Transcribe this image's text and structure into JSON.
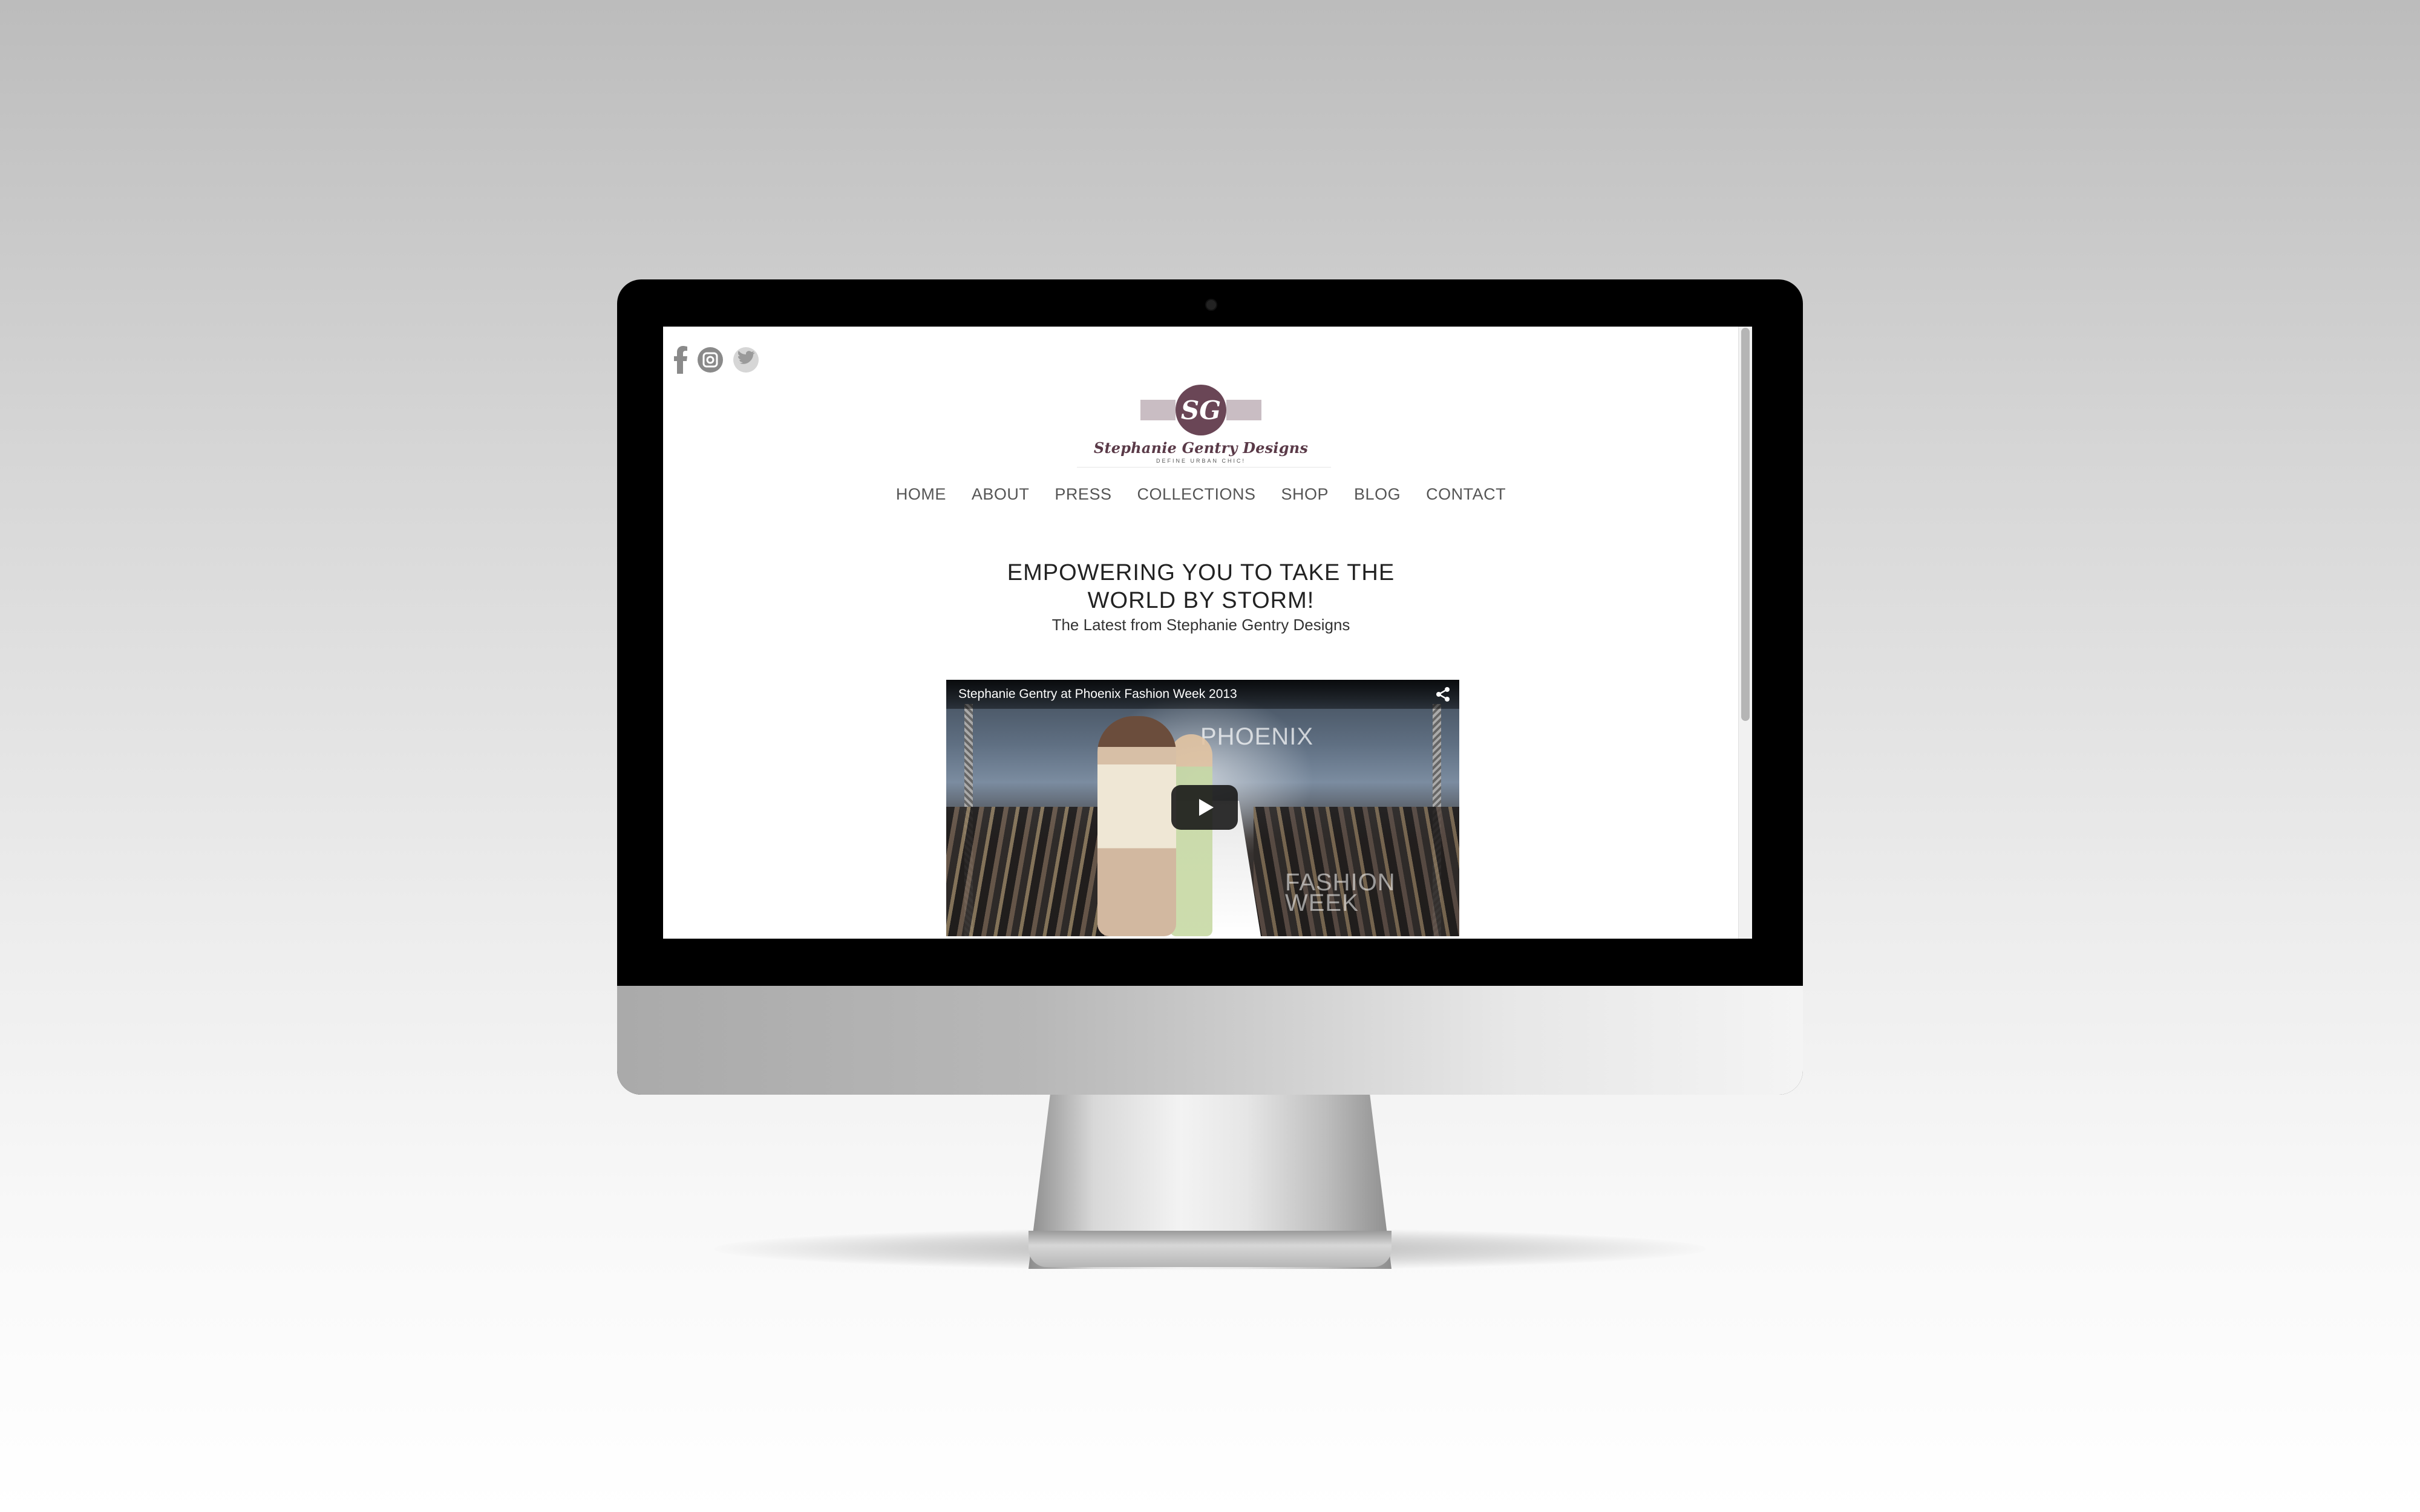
{
  "social": {
    "icons": [
      "facebook-icon",
      "instagram-icon",
      "twitter-icon"
    ]
  },
  "logo": {
    "monogram": "SG",
    "name": "Stephanie Gentry Designs",
    "tagline": "DEFINE URBAN CHIC!"
  },
  "nav": {
    "items": [
      "HOME",
      "ABOUT",
      "PRESS",
      "COLLECTIONS",
      "SHOP",
      "BLOG",
      "CONTACT"
    ]
  },
  "hero": {
    "headline_line1": "EMPOWERING YOU TO TAKE THE",
    "headline_line2": "WORLD BY STORM!",
    "subhead": "The Latest from Stephanie Gentry Designs"
  },
  "video": {
    "title": "Stephanie Gentry at Phoenix Fashion Week 2013",
    "backdrop_text_1": "PHOENIX",
    "backdrop_text_2": "FASHION WEEK",
    "play_icon": "play-icon",
    "share_icon": "share-icon"
  },
  "colors": {
    "brand": "#6a4656",
    "nav_text": "#555555",
    "headline": "#222222"
  }
}
